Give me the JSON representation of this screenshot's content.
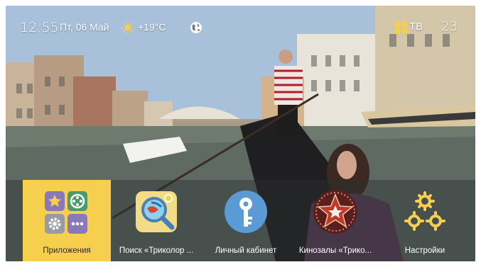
{
  "status_bar": {
    "time": "12:55",
    "date": "Пт, 06 Май",
    "weather_icon": "sun-icon",
    "temperature": "+19°C",
    "globe_icon": "globe-icon",
    "tv_icon": "grid-icon",
    "tv_label": "ТВ",
    "channel_number": "23"
  },
  "dock": {
    "items": [
      {
        "label": "Приложения",
        "icon": "apps-grid-icon",
        "active": true
      },
      {
        "label": "Поиск «Триколор ...",
        "icon": "search-globe-icon",
        "active": false
      },
      {
        "label": "Личный кабинет",
        "icon": "key-icon",
        "active": false
      },
      {
        "label": "Кинозалы «Трико...",
        "icon": "cinema-star-icon",
        "active": false
      },
      {
        "label": "Настройки",
        "icon": "gears-icon",
        "active": false
      }
    ]
  },
  "colors": {
    "accent": "#f6cf4e",
    "dock_bg": "rgba(40,45,48,0.42)",
    "text": "#ffffff"
  }
}
